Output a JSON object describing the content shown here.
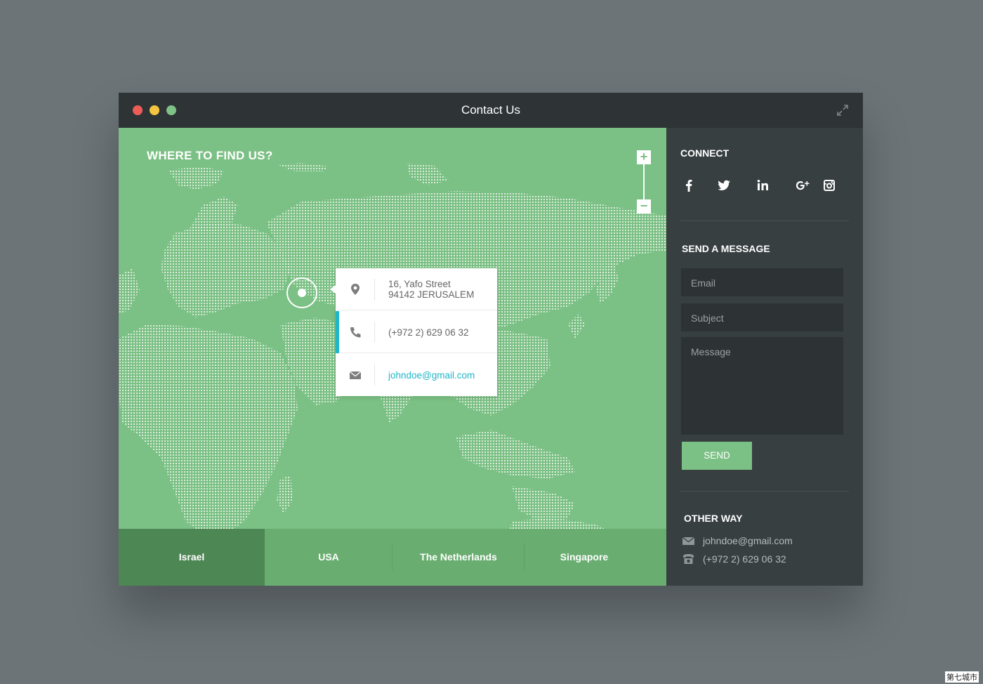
{
  "window": {
    "title": "Contact Us"
  },
  "map": {
    "title": "WHERE TO FIND US?",
    "zoom_in": "+",
    "zoom_out": "−",
    "info": {
      "address_line1": "16, Yafo Street",
      "address_line2": "94142 JERUSALEM",
      "phone": "(+972 2) 629 06 32",
      "email": "johndoe@gmail.com"
    },
    "tabs": [
      {
        "label": "Israel",
        "active": true
      },
      {
        "label": "USA",
        "active": false
      },
      {
        "label": "The Netherlands",
        "active": false
      },
      {
        "label": "Singapore",
        "active": false
      }
    ]
  },
  "sidebar": {
    "connect_title": "CONNECT",
    "social": [
      "facebook-icon",
      "twitter-icon",
      "linkedin-icon",
      "google-plus-icon",
      "instagram-icon"
    ],
    "message_title": "SEND A MESSAGE",
    "email_placeholder": "Email",
    "subject_placeholder": "Subject",
    "message_placeholder": "Message",
    "send_label": "SEND",
    "other_title": "OTHER WAY",
    "other_email": "johndoe@gmail.com",
    "other_phone": "(+972 2) 629 06 32"
  },
  "watermark": "第七城市",
  "colors": {
    "map_green": "#7bc084",
    "tab_active": "#4d8754",
    "accent_cyan": "#1fb6c8",
    "sidebar": "#383f41"
  }
}
